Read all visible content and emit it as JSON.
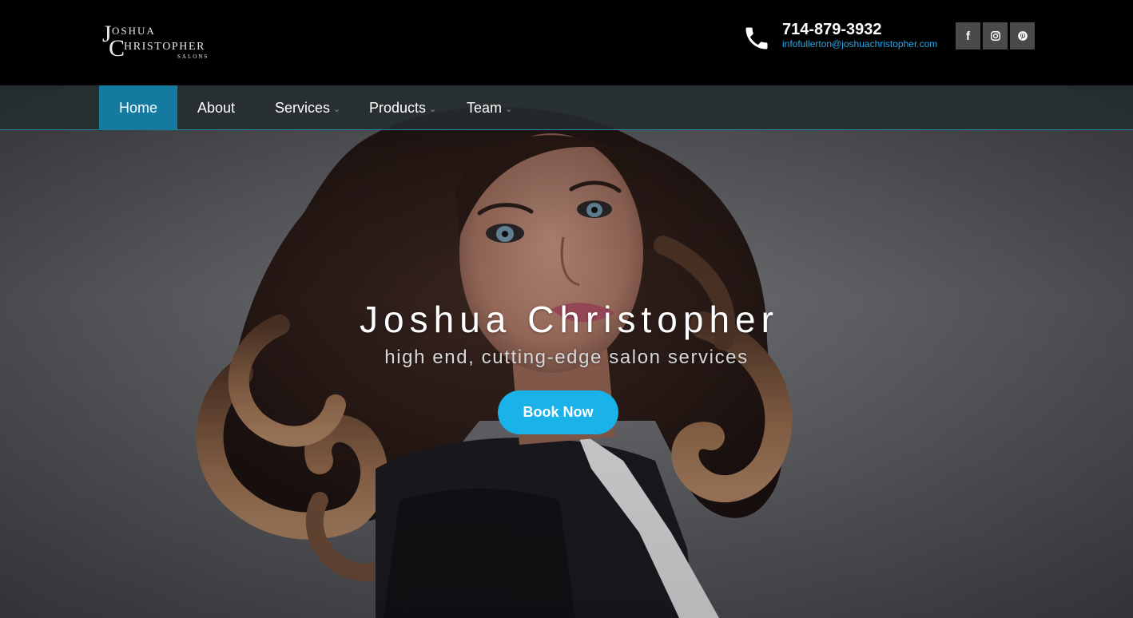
{
  "header": {
    "logo": {
      "line1_initial": "J",
      "line1_rest": "OSHUA",
      "line2_initial": "C",
      "line2_rest": "HRISTOPHER",
      "line3": "SALONS"
    },
    "phone": "714-879-3932",
    "email": "infofullerton@joshuachristopher.com",
    "social": [
      {
        "icon": "facebook-icon",
        "glyph": "f"
      },
      {
        "icon": "instagram-icon"
      },
      {
        "icon": "pinterest-icon"
      }
    ]
  },
  "nav": {
    "items": [
      {
        "label": "Home",
        "active": true,
        "dropdown": false
      },
      {
        "label": "About",
        "active": false,
        "dropdown": false
      },
      {
        "label": "Services",
        "active": false,
        "dropdown": true
      },
      {
        "label": "Products",
        "active": false,
        "dropdown": true
      },
      {
        "label": "Team",
        "active": false,
        "dropdown": true
      }
    ],
    "caret": "⌄"
  },
  "hero": {
    "title": "Joshua Christopher",
    "subtitle": "high end, cutting-edge salon services",
    "cta_label": "Book Now"
  },
  "colors": {
    "accent": "#19b3ea",
    "nav_active": "#157aa0",
    "email_link": "#2aa6e8"
  }
}
